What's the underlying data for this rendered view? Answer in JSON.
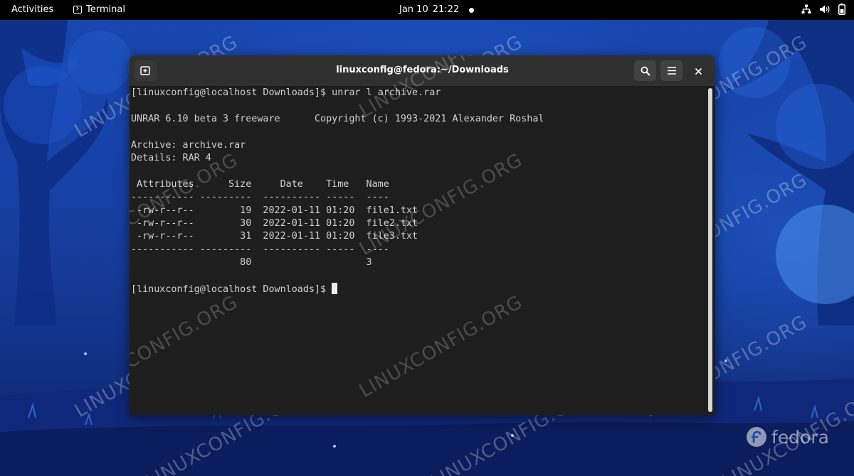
{
  "topbar": {
    "activities": "Activities",
    "app_name": "Terminal",
    "date": "Jan 10",
    "time": "21:22"
  },
  "window": {
    "title": "linuxconfig@fedora:~/Downloads"
  },
  "terminal": {
    "lines": [
      "[linuxconfig@localhost Downloads]$ unrar l archive.rar",
      "",
      "UNRAR 6.10 beta 3 freeware      Copyright (c) 1993-2021 Alexander Roshal",
      "",
      "Archive: archive.rar",
      "Details: RAR 4",
      "",
      " Attributes      Size     Date    Time   Name",
      "----------- ---------  ---------- -----  ----",
      " -rw-r--r--        19  2022-01-11 01:20  file1.txt",
      " -rw-r--r--        30  2022-01-11 01:20  file2.txt",
      " -rw-r--r--        31  2022-01-11 01:20  file3.txt",
      "----------- ---------  ---------- -----  ----",
      "                   80                    3",
      ""
    ],
    "prompt": "[linuxconfig@localhost Downloads]$ "
  },
  "wallpaper": {
    "watermark": "LINUXCONFIG.ORG",
    "brand": "fedora"
  }
}
